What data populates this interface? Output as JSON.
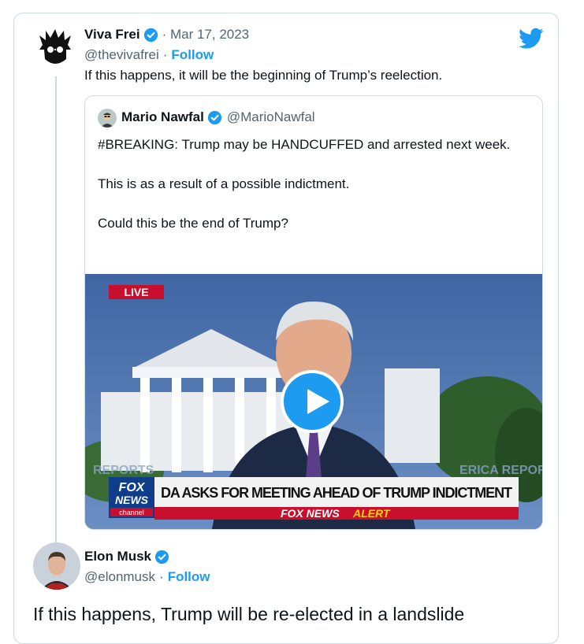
{
  "main_tweet": {
    "author_name": "Viva Frei",
    "date": "· Mar 17, 2023",
    "handle": "@thevivafrei",
    "separator": "·",
    "follow_label": "Follow",
    "text": "If this happens, it will be the beginning of Trump’s reelection."
  },
  "quoted_tweet": {
    "author_name": "Mario Nawfal",
    "handle": "@MarioNawfal",
    "paragraphs": [
      "#BREAKING: Trump may be HANDCUFFED and arrested next week.",
      "This is as a result of a possible indictment.",
      "Could this be the end of Trump?"
    ],
    "video": {
      "live_badge": "LIVE",
      "logo_line1": "FOX",
      "logo_line2": "NEWS",
      "logo_line3": "channel",
      "headline": "DA ASKS FOR MEETING AHEAD OF TRUMP INDICTMENT",
      "alert_prefix": "FOX NEWS",
      "alert_word": "ALERT",
      "bg_text_left": "REPORTS",
      "bg_text_right": "ERICA REPOR"
    }
  },
  "reply_tweet": {
    "author_name": "Elon Musk",
    "handle": "@elonmusk",
    "separator": "·",
    "follow_label": "Follow",
    "text": "If this happens, Trump will be re-elected in a landslide"
  },
  "icons": {
    "brand": "twitter-bird-icon",
    "verified": "verified-badge-icon",
    "play": "play-icon"
  },
  "colors": {
    "accent": "#1d9bf0",
    "muted": "#536471",
    "border": "#cfd9de",
    "fox_red": "#c8102e"
  }
}
